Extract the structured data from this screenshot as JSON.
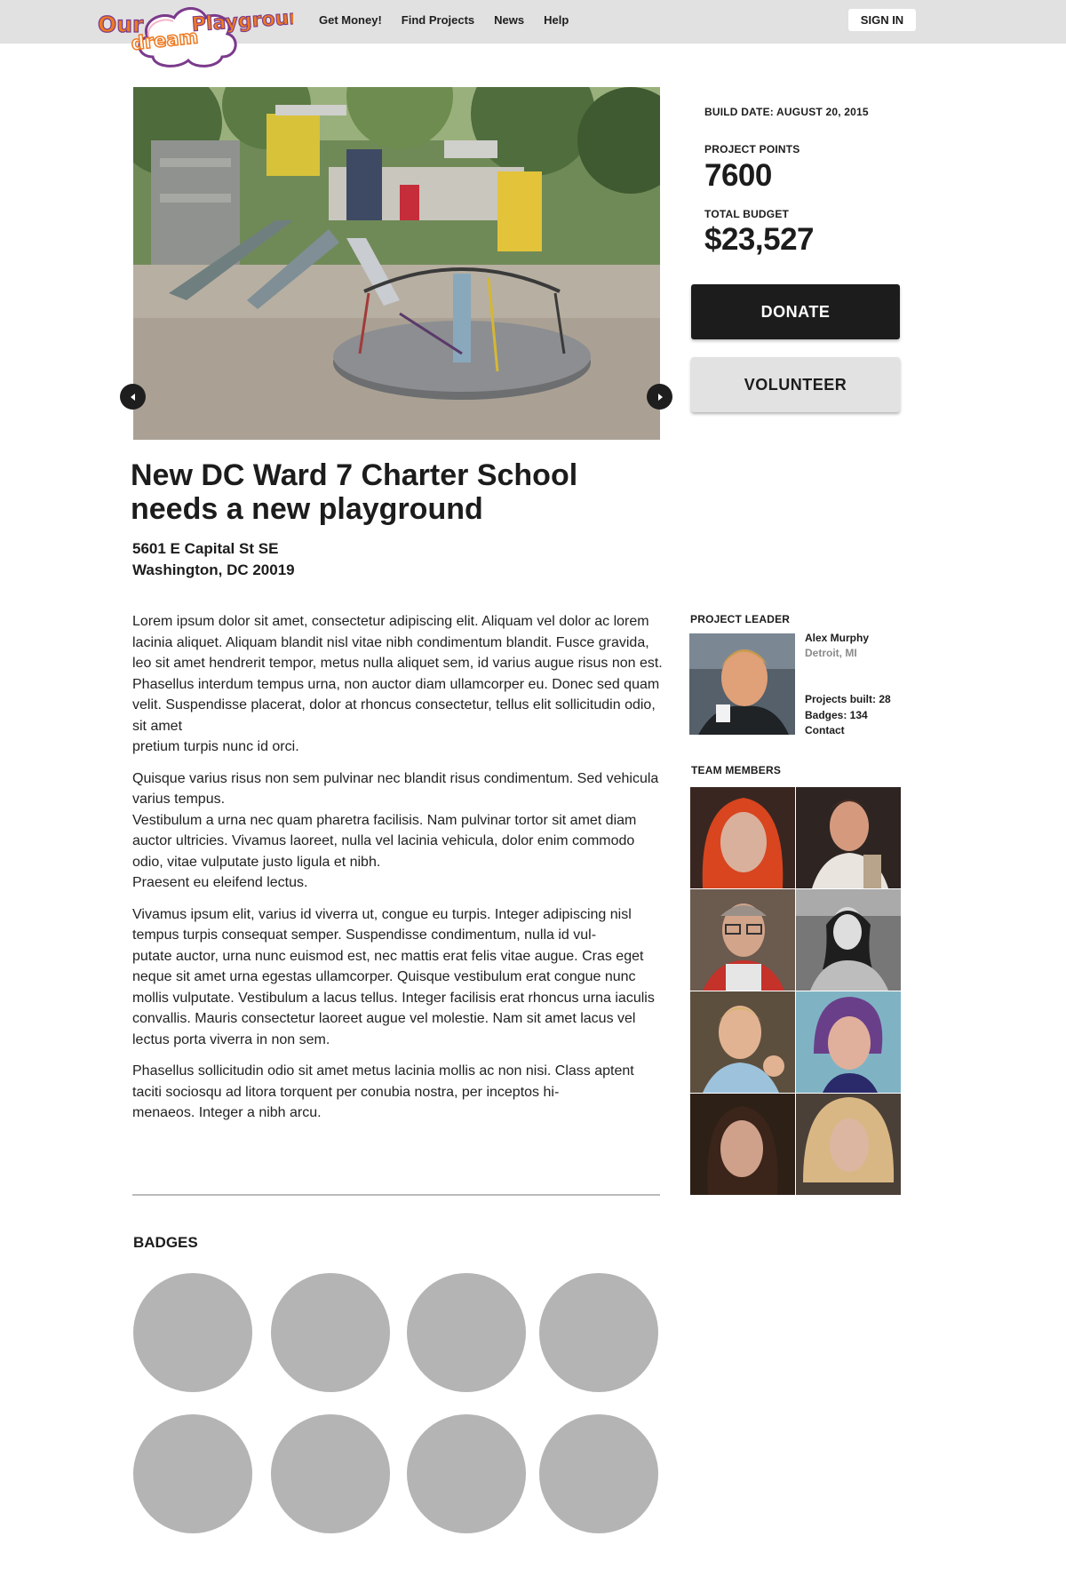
{
  "header": {
    "logo_text": "Our dream Playground",
    "nav": [
      "Get Money!",
      "Find Projects",
      "News",
      "Help"
    ],
    "sign_in": "SIGN IN"
  },
  "project": {
    "build_date": "BUILD DATE: AUGUST 20, 2015",
    "points_label": "PROJECT POINTS",
    "points": "7600",
    "budget_label": "TOTAL BUDGET",
    "budget": "$23,527",
    "donate": "DONATE",
    "volunteer": "VOLUNTEER",
    "title": "New DC Ward 7 Charter School needs a new playground",
    "address_line1": "5601 E Capital St SE",
    "address_line2": "Washington, DC 20019"
  },
  "body": {
    "p1": "Lorem ipsum dolor sit amet, consectetur adipiscing elit. Aliquam vel dolor ac lorem lacinia aliquet. Aliquam blandit nisl vitae nibh condimentum blandit. Fusce gravida, leo sit amet hendrerit tempor, metus nulla aliquet sem, id varius augue risus non est. Phasellus interdum tempus urna, non auctor diam ullamcorper eu. Donec sed quam velit. Suspendisse placerat, dolor at rhoncus consectetur, tellus elit sollicitudin odio, sit amet\npretium turpis nunc id orci.",
    "p2": "Quisque varius risus non sem pulvinar nec blandit risus condimentum. Sed vehicula varius tempus.\nVestibulum a urna nec quam pharetra facilisis. Nam pulvinar tortor sit amet diam auctor ultricies. Vivamus laoreet, nulla vel lacinia vehicula, dolor enim commodo odio, vitae vulputate justo ligula et nibh.\nPraesent eu eleifend lectus.",
    "p3": "Vivamus ipsum elit, varius id viverra ut, congue eu turpis. Integer adipiscing nisl tempus turpis consequat semper. Suspendisse condimentum, nulla id vul-\nputate auctor, urna nunc euismod est, nec mattis erat felis vitae augue. Cras eget neque sit amet urna egestas ullamcorper. Quisque vestibulum erat congue nunc mollis vulputate. Vestibulum a lacus tellus. Integer facilisis erat rhoncus urna iaculis convallis. Mauris consectetur laoreet augue vel molestie. Nam sit amet lacus vel lectus porta viverra in non sem.",
    "p4": " Phasellus sollicitudin odio sit amet metus lacinia mollis ac non nisi. Class aptent taciti sociosqu ad litora torquent per conubia nostra, per inceptos hi-\nmenaeos. Integer a nibh arcu."
  },
  "leader": {
    "label": "PROJECT LEADER",
    "name": "Alex Murphy",
    "location": "Detroit, MI",
    "projects_built": "Projects built: 28",
    "badges": "Badges: 134",
    "contact": "Contact"
  },
  "team": {
    "label": "TEAM MEMBERS"
  },
  "badges": {
    "label": "BADGES"
  },
  "colors": {
    "header_bg": "#e1e1e1",
    "donate_bg": "#1c1c1c",
    "volunteer_bg": "#e2e2e2",
    "badge_placeholder": "#b4b4b4",
    "logo_orange": "#ee7a22",
    "logo_purple": "#7b3a8c"
  },
  "icons": [
    "chevron-left-icon",
    "chevron-right-icon"
  ]
}
